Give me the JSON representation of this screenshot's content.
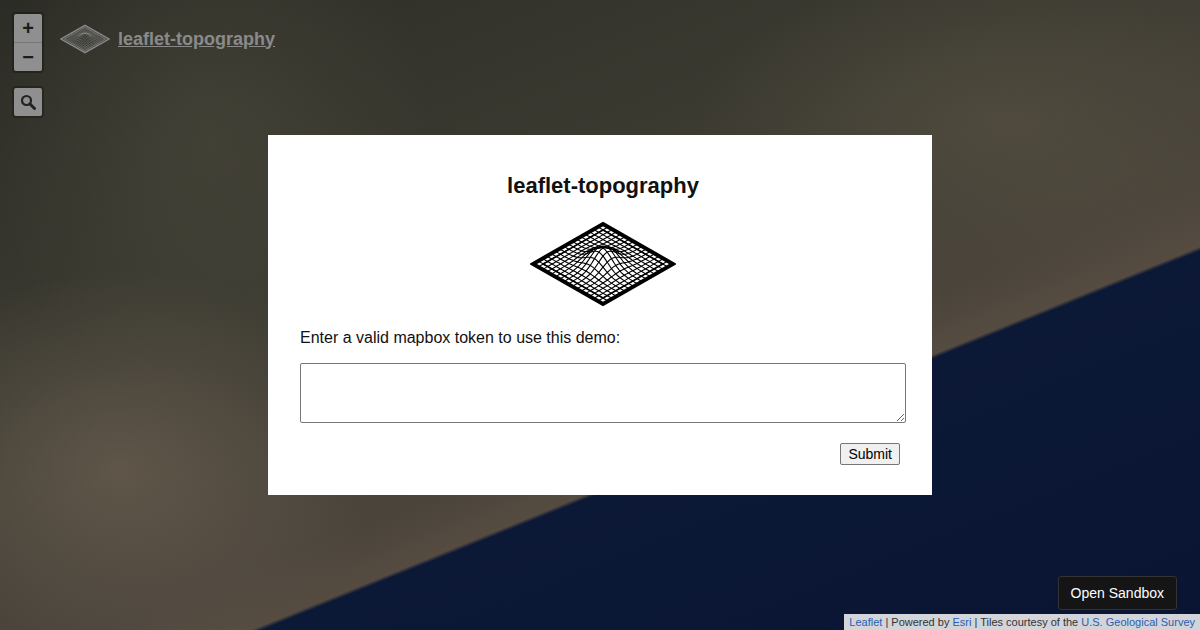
{
  "zoom": {
    "in": "+",
    "out": "−"
  },
  "logo": {
    "text": "leaflet-topography"
  },
  "modal": {
    "title": "leaflet-topography",
    "label": "Enter a valid mapbox token to use this demo:",
    "submit": "Submit"
  },
  "sandbox_button": "Open Sandbox",
  "attribution": [
    {
      "text": "Leaflet",
      "kind": "link"
    },
    {
      "text": " | Powered by ",
      "kind": "text"
    },
    {
      "text": "Esri",
      "kind": "link"
    },
    {
      "text": " | Tiles courtesy of the ",
      "kind": "text"
    },
    {
      "text": "U.S. Geological Survey",
      "kind": "link"
    }
  ]
}
